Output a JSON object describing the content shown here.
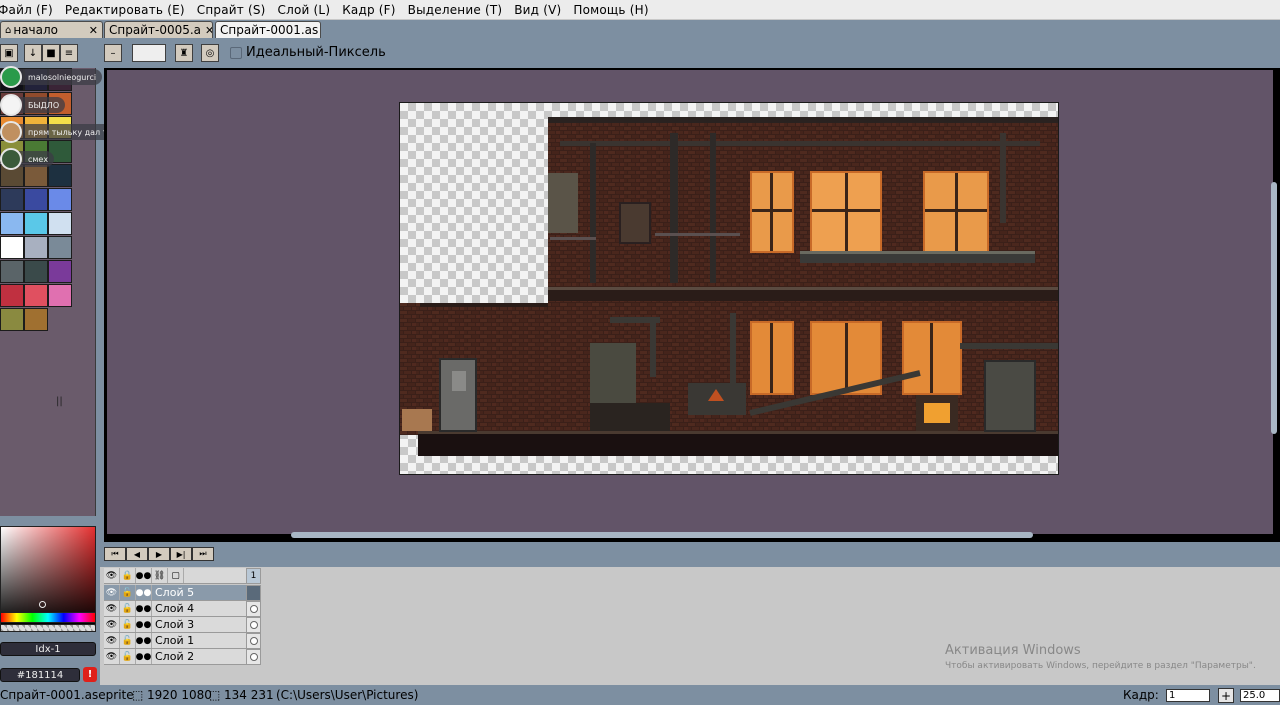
{
  "menu": [
    "Файл (F)",
    "Редактировать (E)",
    "Спрайт (S)",
    "Слой (L)",
    "Кадр (F)",
    "Выделение (T)",
    "Вид (V)",
    "Помощь (H)"
  ],
  "tabs": [
    {
      "label": "начало"
    },
    {
      "label": "Спрайт-0005.a"
    },
    {
      "label": "Спрайт-0001.as"
    }
  ],
  "toolbar": {
    "pixel_perfect_label": "Идеальный-Пиксель"
  },
  "palette": {
    "colors": [
      "#0f0f17",
      "#22223a",
      "#3a2436",
      "#693b3a",
      "#914b2c",
      "#c25e2d",
      "#e88a30",
      "#f0b33a",
      "#f4e04a",
      "#8a8f3a",
      "#4a7a34",
      "#2f5a3a",
      "#5a4a34",
      "#7a5a3a",
      "#1d3040",
      "#2d3a5a",
      "#3a4aa0",
      "#6a8ae8",
      "#8ab8f0",
      "#5ac8e8",
      "#d0e0f0",
      "#ffffff",
      "#a8b0c0",
      "#7a8a98",
      "#5a6468",
      "#3a4a4a",
      "#7a3a9a",
      "#c03040",
      "#e05060",
      "#e070b0",
      "#8a8a40",
      "#a07030"
    ],
    "index_label": "||"
  },
  "notifications": [
    {
      "text": "malosolnieogurci"
    },
    {
      "text": "БЫДЛО"
    },
    {
      "text": "прям тыльку дал телик сломал"
    },
    {
      "text": "смех"
    }
  ],
  "color_picker": {
    "index_label": "Idx-1",
    "hex": "#181114",
    "warn": "!"
  },
  "timeline": {
    "frame_number": "1",
    "layers": [
      {
        "name": "Слой 5",
        "selected": true
      },
      {
        "name": "Слой 4"
      },
      {
        "name": "Слой 3"
      },
      {
        "name": "Слой 1"
      },
      {
        "name": "Слой 2"
      }
    ]
  },
  "watermark": {
    "title": "Активация Windows",
    "subtitle": "Чтобы активировать Windows, перейдите в раздел \"Параметры\"."
  },
  "status": {
    "filename": "Спрайт-0001.aseprite",
    "size": "1920 1080",
    "pos": "134 231",
    "path": "(C:\\Users\\User\\Pictures)",
    "frame_label": "Кадр:",
    "frame_value": "1",
    "zoom": "25.0"
  }
}
